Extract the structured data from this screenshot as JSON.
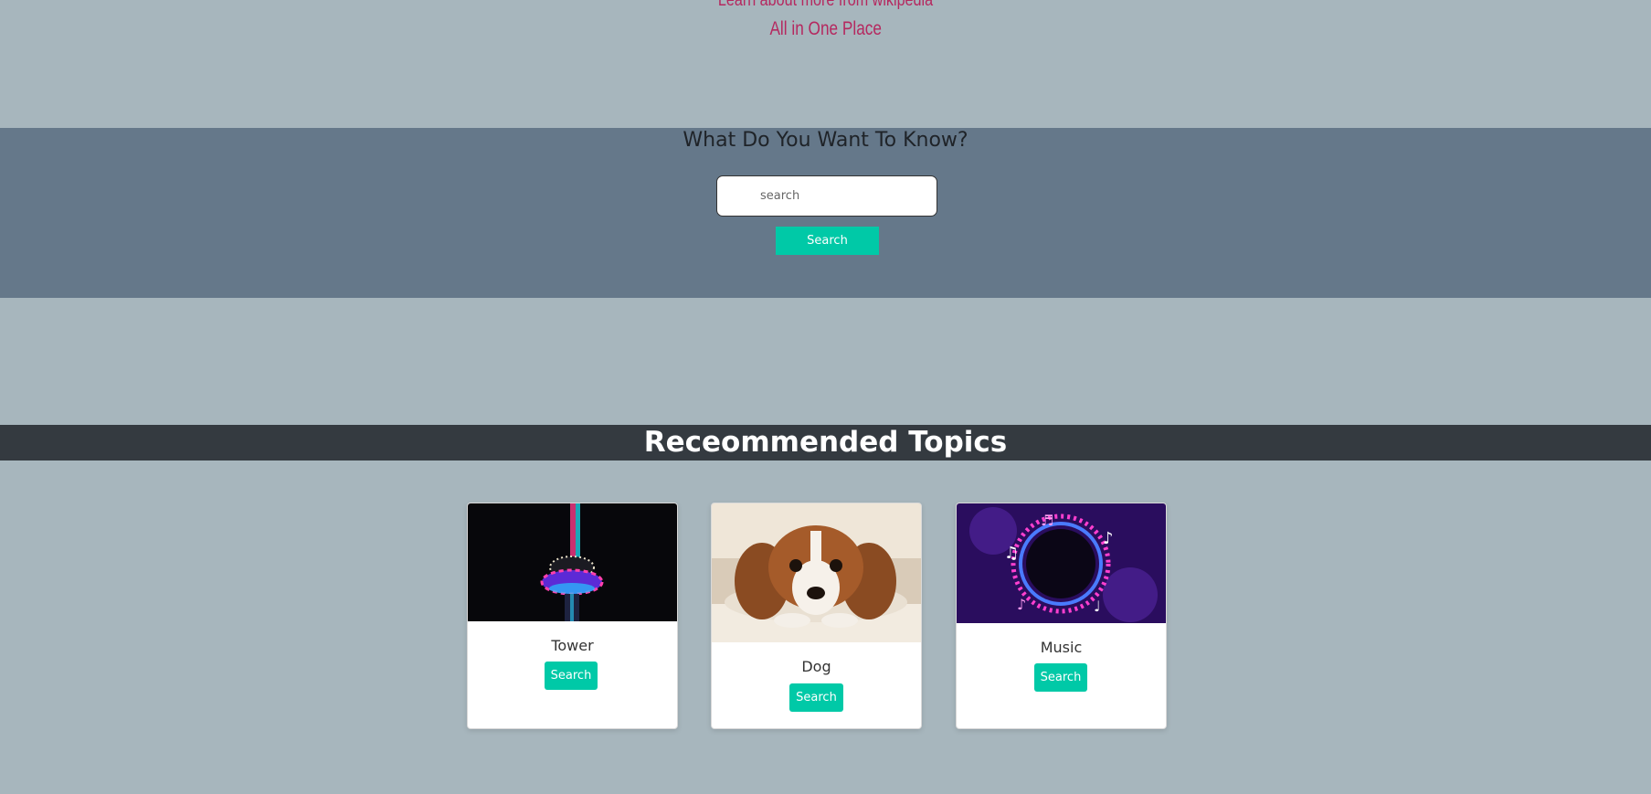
{
  "hero": {
    "tagline_top": "Learn about more from wikipedia",
    "tagline": "All in One Place"
  },
  "search": {
    "heading": "What Do You Want To Know?",
    "placeholder": "search",
    "button_label": "Search"
  },
  "topics": {
    "heading": "Receommended Topics",
    "cards": [
      {
        "title": "Tower",
        "button_label": "Search",
        "image": "tower-photo"
      },
      {
        "title": "Dog",
        "button_label": "Search",
        "image": "dog-photo"
      },
      {
        "title": "Music",
        "button_label": "Search",
        "image": "music-photo"
      }
    ]
  },
  "colors": {
    "accent": "#00c9a7",
    "tagline": "#b5285f",
    "page_bg": "#a7b6bd",
    "search_band": "#65788a",
    "topics_band": "#343a40"
  }
}
